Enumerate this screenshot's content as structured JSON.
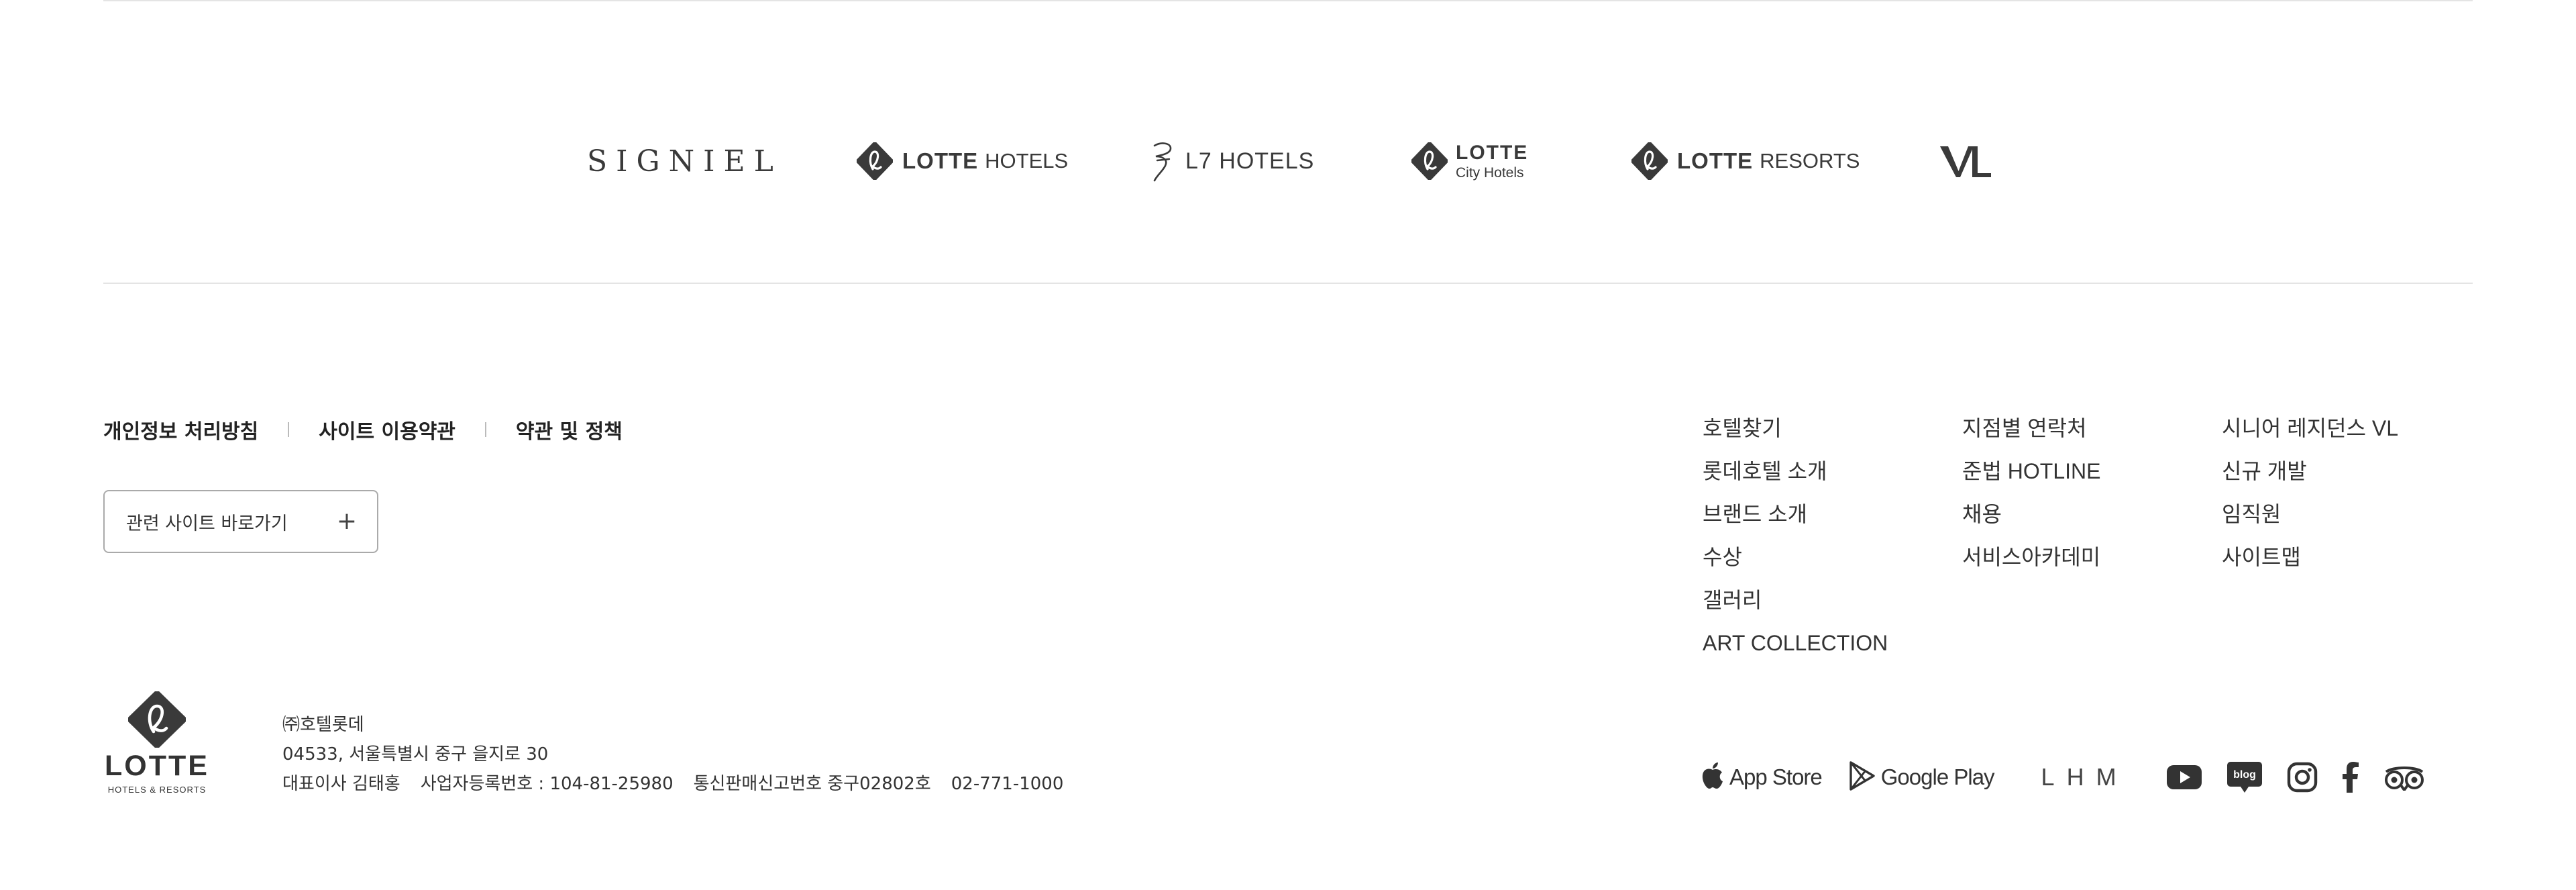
{
  "brands": {
    "signiel": "SIGNIEL",
    "lotte_hotels": {
      "lotte": "LOTTE",
      "hotels": "HOTELS"
    },
    "l7_hotels": "L7 HOTELS",
    "lotte_city_hotels": {
      "lotte": "LOTTE",
      "city": "City Hotels"
    },
    "lotte_resorts": {
      "lotte": "LOTTE",
      "resorts": "RESORTS"
    },
    "vl": "VL"
  },
  "policies": [
    "개인정보 처리방침",
    "사이트 이용약관",
    "약관 및 정책"
  ],
  "related_sites": {
    "label": "관련 사이트 바로가기",
    "toggle": "+"
  },
  "nav": {
    "col1": [
      "호텔찾기",
      "롯데호텔 소개",
      "브랜드 소개",
      "수상",
      "갤러리",
      "ART COLLECTION"
    ],
    "col2": [
      "지점별 연락처",
      "준법 HOTLINE",
      "채용",
      "서비스아카데미"
    ],
    "col3": [
      "시니어 레지던스 VL",
      "신규 개발",
      "임직원",
      "사이트맵"
    ]
  },
  "corp_logo": {
    "word": "LOTTE",
    "sub": "HOTELS & RESORTS"
  },
  "company": {
    "name": "㈜호텔롯데",
    "address": "04533, 서울특별시 중구 을지로 30",
    "ceo": "대표이사 김태홍",
    "business_no": "사업자등록번호 : 104-81-25980",
    "mail_order_no": "통신판매신고번호 중구02802호",
    "phone": "02-771-1000"
  },
  "apps": {
    "app_store": "App Store",
    "google_play": "Google Play",
    "lhm": "LHM"
  },
  "social": {
    "icons": [
      "youtube-icon",
      "blog-icon",
      "instagram-icon",
      "facebook-icon",
      "tripadvisor-icon"
    ],
    "blog_text": "blog"
  }
}
